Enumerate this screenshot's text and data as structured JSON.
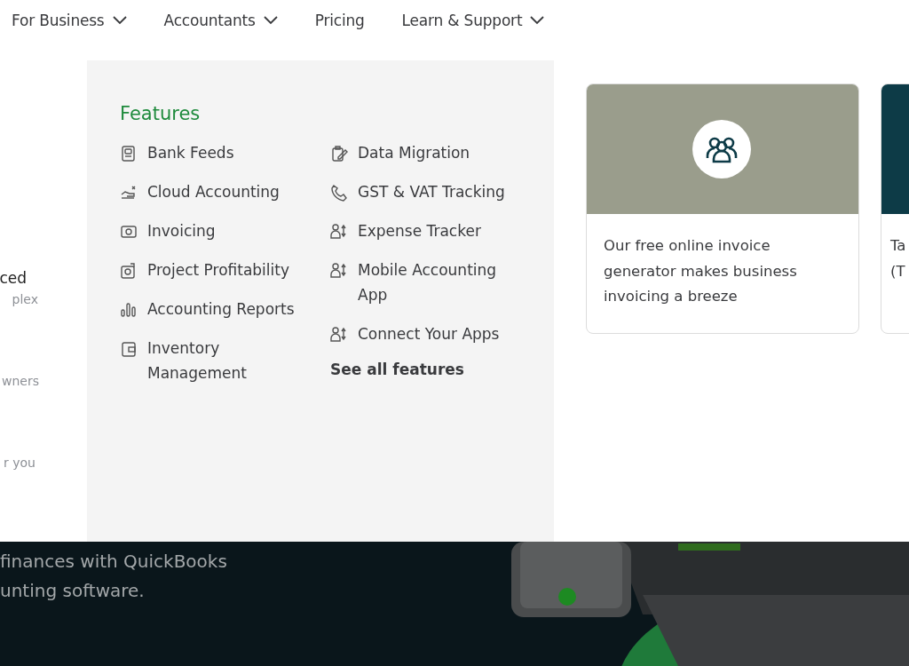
{
  "nav": [
    {
      "label": "For Business",
      "dropdown": true
    },
    {
      "label": "Accountants",
      "dropdown": true
    },
    {
      "label": "Pricing",
      "dropdown": false
    },
    {
      "label": "Learn & Support",
      "dropdown": true
    }
  ],
  "side_fragments": [
    {
      "title": "ced",
      "sub": "plex"
    },
    {
      "sub": "wners"
    },
    {
      "sub": "r you"
    }
  ],
  "features": {
    "heading": "Features",
    "columns": [
      [
        {
          "label": "Bank Feeds"
        },
        {
          "label": "Cloud Accounting"
        },
        {
          "label": "Invoicing"
        },
        {
          "label": "Project Profitability"
        },
        {
          "label": "Accounting Reports"
        },
        {
          "label": "Inventory Management"
        }
      ],
      [
        {
          "label": "Data Migration"
        },
        {
          "label": "GST & VAT Tracking"
        },
        {
          "label": "Expense Tracker"
        },
        {
          "label": "Mobile Accounting App"
        },
        {
          "label": "Connect Your Apps"
        }
      ]
    ],
    "see_all": "See all features"
  },
  "cards": [
    {
      "kind": "photo",
      "lines": [
        "Our free online invoice",
        "generator makes business",
        "invoicing a breeze"
      ]
    },
    {
      "kind": "dark",
      "lines": [
        "Ta",
        "(T"
      ]
    }
  ],
  "hero": {
    "lines": [
      "finances with QuickBooks",
      "unting software."
    ]
  }
}
